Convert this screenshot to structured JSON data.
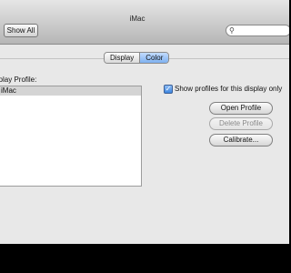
{
  "window": {
    "title": "iMac"
  },
  "toolbar": {
    "show_all_label": "Show All",
    "search_placeholder": ""
  },
  "tabs": [
    {
      "label": "Display",
      "active": false
    },
    {
      "label": "Color",
      "active": true
    }
  ],
  "color_pane": {
    "profile_label": "Display Profile:",
    "profiles": [
      "iMac"
    ],
    "selected_profile": "iMac",
    "show_profiles_checkbox": {
      "label": "Show profiles for this display only",
      "checked": true
    },
    "buttons": {
      "open_profile": "Open Profile",
      "delete_profile": "Delete Profile",
      "calibrate": "Calibrate..."
    }
  },
  "colors": {
    "active_tab": "#7fb1f0",
    "checkbox": "#3d86e0"
  },
  "icons": {
    "search": "search-icon",
    "checkmark": "checkmark-icon"
  }
}
